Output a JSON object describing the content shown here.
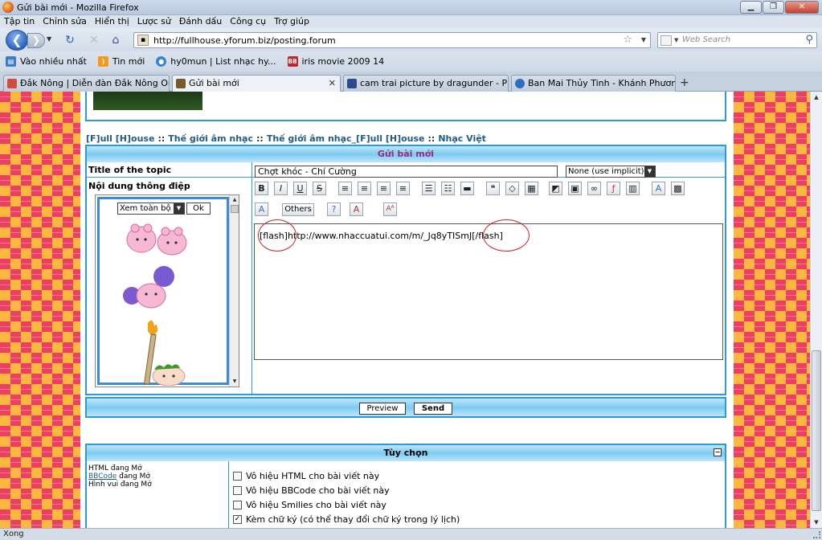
{
  "window": {
    "title": "Gửi bài mới - Mozilla Firefox"
  },
  "menu": [
    "Tập tin",
    "Chỉnh sửa",
    "Hiển thị",
    "Lược sử",
    "Đánh dấu",
    "Công cụ",
    "Trợ giúp"
  ],
  "nav": {
    "url": "http://fullhouse.yforum.biz/posting.forum",
    "search_placeholder": "Web Search"
  },
  "bookmarks": [
    {
      "label": "Vào nhiều nhất",
      "icon": "most-visited-icon",
      "color": "#3e7bc8"
    },
    {
      "label": "Tin mới",
      "icon": "rss-feed-icon",
      "color": "#f39a1e"
    },
    {
      "label": "hy0mun | List nhạc hy...",
      "icon": "site-icon",
      "color": "#3a86c8"
    },
    {
      "label": "iris movie 2009 14",
      "icon": "iris-site-icon",
      "color": "#c3262e",
      "badge": "88"
    }
  ],
  "tabs": [
    {
      "label": "Đắk Nông | Diễn đàn Đắk Nông Onl...",
      "active": false,
      "icon_color": "#d24d3a"
    },
    {
      "label": "Gửi bài mới",
      "active": true,
      "icon_color": "#7a5a2a"
    },
    {
      "label": "cam trai picture by dragunder - Pho...",
      "active": false,
      "icon_color": "#2d4a8c"
    },
    {
      "label": "Ban Mai Thủy Tinh - Khánh Phương...",
      "active": false,
      "icon_color": "#2a6fc0"
    }
  ],
  "breadcrumb": [
    "[F]ull [H]ouse",
    "Thế giới âm nhạc",
    "Thế giới âm nhạc_[F]ull [H]ouse",
    "Nhạc Việt"
  ],
  "breadcrumb_sep": "::",
  "post": {
    "header": "Gửi bài mới",
    "title_label": "Title of the topic",
    "title_value": "Chợt khóc - Chí Cường",
    "icon_option": "None (use implicit)",
    "message_label": "Nội dung thông điệp",
    "smilies_view": "Xem toàn bộ",
    "ok_label": "Ok",
    "others_label": "Others",
    "editor_text": "[flash]http://www.nhaccuatui.com/m/_Jq8yTISmJ[/flash]"
  },
  "toolbar": {
    "row1": [
      {
        "name": "bold-icon",
        "glyph": "B"
      },
      {
        "name": "italic-icon",
        "glyph": "I"
      },
      {
        "name": "underline-icon",
        "glyph": "U"
      },
      {
        "name": "strikethrough-icon",
        "glyph": "S"
      },
      {
        "name": "align-left-icon",
        "glyph": "≡"
      },
      {
        "name": "align-center-icon",
        "glyph": "≡"
      },
      {
        "name": "align-right-icon",
        "glyph": "≡"
      },
      {
        "name": "justify-icon",
        "glyph": "≡"
      },
      {
        "name": "bullet-list-icon",
        "glyph": "☰"
      },
      {
        "name": "numbered-list-icon",
        "glyph": "☷"
      },
      {
        "name": "horizontal-rule-icon",
        "glyph": "▬"
      },
      {
        "name": "quote-icon",
        "glyph": "❝"
      },
      {
        "name": "code-icon",
        "glyph": "◇"
      },
      {
        "name": "table-icon",
        "glyph": "▦"
      },
      {
        "name": "spoiler-icon",
        "glyph": "◩"
      },
      {
        "name": "image-icon",
        "glyph": "▣"
      },
      {
        "name": "link-icon",
        "glyph": "∞"
      },
      {
        "name": "flash-icon",
        "glyph": "ƒ"
      },
      {
        "name": "video-icon",
        "glyph": "▥"
      },
      {
        "name": "font-icon",
        "glyph": "A"
      },
      {
        "name": "color-icon",
        "glyph": "▩"
      }
    ],
    "row2": [
      {
        "name": "font-size-icon",
        "glyph": "A"
      },
      {
        "name": "help-icon",
        "glyph": "?"
      },
      {
        "name": "font-color-icon",
        "glyph": "A"
      },
      {
        "name": "text-size-icon",
        "glyph": "Aᴬ"
      }
    ]
  },
  "submit": {
    "preview": "Preview",
    "send": "Send"
  },
  "options": {
    "header": "Tùy chọn",
    "html_status": "HTML đang Mở",
    "bbcode_link": "BBCode",
    "bbcode_status": "đang Mở",
    "smilies_status": "Hình vui đang Mở",
    "checkboxes": [
      {
        "label": "Vô hiệu HTML cho bài viết này",
        "checked": false
      },
      {
        "label": "Vô hiệu BBCode cho bài viết này",
        "checked": false
      },
      {
        "label": "Vô hiệu Smilies cho bài viết này",
        "checked": false
      },
      {
        "label": "Kèm chữ ký (có thể thay đổi chữ ký trong lý lịch)",
        "checked": true
      }
    ]
  },
  "status": {
    "text": "Xong"
  },
  "colors": {
    "forum_blue": "#2c9ad8",
    "header_purple": "#9b2a7a",
    "link_blue": "#1f5d86",
    "annotation_red": "#cc2222"
  }
}
